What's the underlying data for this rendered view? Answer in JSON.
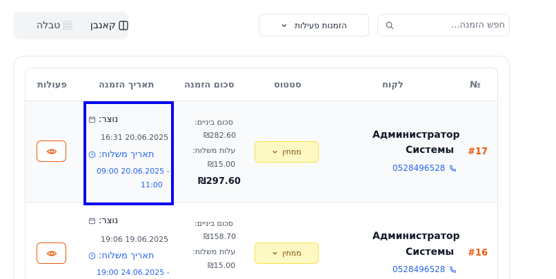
{
  "search": {
    "placeholder": "חפש הזמנה..."
  },
  "filter": {
    "label": "הזמנות פעילות"
  },
  "view_toggle": {
    "kanban": "קאנבן",
    "table": "טבלה"
  },
  "table": {
    "headers": {
      "num": "№",
      "customer": "לקוח",
      "status": "סטטוס",
      "amount": "סכום הזמנה",
      "date": "תאריך הזמנה",
      "actions": "פעולות"
    },
    "rows": [
      {
        "order_number": "#17",
        "customer_line1": "Администратор",
        "customer_line2": "Системы",
        "phone": "0528496528",
        "status": "ממתין",
        "subtotal_label": "סכום ביניים:",
        "subtotal": "₪282.60",
        "delivery_label": "עלות משלוח:",
        "delivery": "₪15.00",
        "total": "₪297.60",
        "created_label": "נוצר:",
        "created": "16:31 20.06.2025",
        "delivery_date_label": "תאריך משלוח:",
        "delivery_date_line1": "09:00 20.06.2025 -",
        "delivery_date_line2": "11:00"
      },
      {
        "order_number": "#16",
        "customer_line1": "Администратор",
        "customer_line2": "Системы",
        "phone": "0528496528",
        "status": "ממתין",
        "subtotal_label": "סכום ביניים:",
        "subtotal": "₪158.70",
        "delivery_label": "עלות משלוח:",
        "delivery": "₪15.00",
        "created_label": "נוצר:",
        "created": "19:06 19.06.2025",
        "delivery_date_label": "תאריך משלוח:",
        "delivery_date_line1": "19:00 24.06.2025 -"
      }
    ]
  },
  "colors": {
    "accent": "#ea580c",
    "link": "#2563eb",
    "status_bg": "#fef9c3",
    "highlight": "#0000ee"
  }
}
